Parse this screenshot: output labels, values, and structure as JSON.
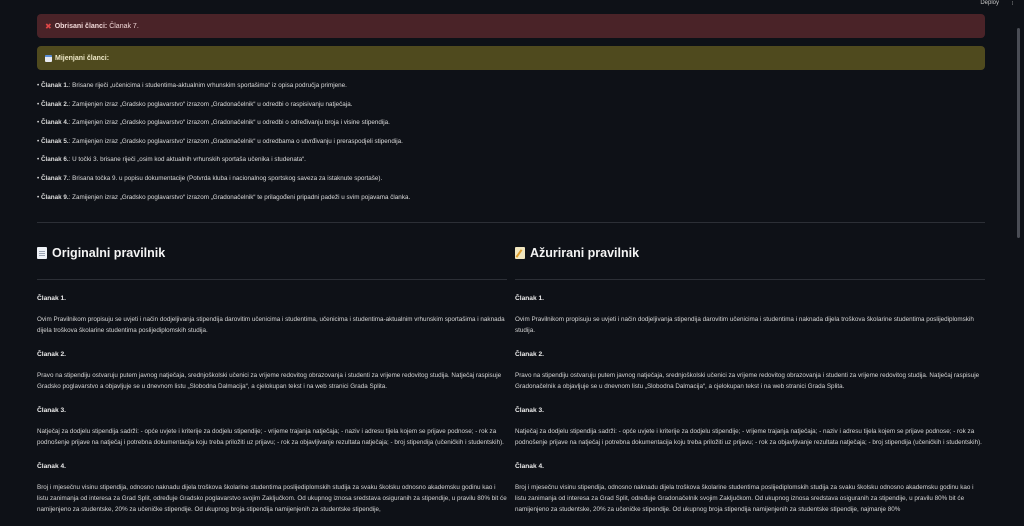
{
  "header": {
    "deploy_label": "Deploy",
    "menu_icon": "⋮"
  },
  "deleted_alert": {
    "icon": "x-icon",
    "label": "Obrisani članci:",
    "value": "Članak 7."
  },
  "changed_alert": {
    "icon": "calendar-icon",
    "label": "Mijenjani članci:"
  },
  "changes": [
    {
      "article": "Članak 1.",
      "text": ": Brisane riječi „učenicima i studentima-aktualnim vrhunskim sportašima“ iz opisa područja primjene."
    },
    {
      "article": "Članak 2.",
      "text": ": Zamijenjen izraz „Gradsko poglavarstvo“ izrazom „Gradonačelnik“ u odredbi o raspisivanju natječaja."
    },
    {
      "article": "Članak 4.",
      "text": ": Zamijenjen izraz „Gradsko poglavarstvo“ izrazom „Gradonačelnik“ u odredbi o određivanju broja i visine stipendija."
    },
    {
      "article": "Članak 5.",
      "text": ": Zamijenjen izraz „Gradsko poglavarstvo“ izrazom „Gradonačelnik“ u odredbama o utvrđivanju i preraspodjeli stipendija."
    },
    {
      "article": "Članak 6.",
      "text": ": U točki 3. brisane riječi „osim kod aktualnih vrhunskih sportaša učenika i studenata“."
    },
    {
      "article": "Članak 7.",
      "text": ": Brisana točka 9. u popisu dokumentacije (Potvrda kluba i nacionalnog sportskog saveza za istaknute sportaše)."
    },
    {
      "article": "Članak 9.",
      "text": ": Zamijenjen izraz „Gradsko poglavarstvo“ izrazom „Gradonačelnik“ te prilagođeni pripadni padeži u svim pojavama članka."
    }
  ],
  "original": {
    "heading": "Originalni pravilnik",
    "articles": [
      {
        "title": "Članak 1.",
        "body": "Ovim Pravilnikom propisuju se uvjeti i način dodjeljivanja stipendija darovitim učenicima i studentima, učenicima i studentima-aktualnim vrhunskim sportašima i naknada dijela troškova školarine studentima poslijediplomskih studija."
      },
      {
        "title": "Članak 2.",
        "body": "Pravo na stipendiju ostvaruju putem javnog natječaja, srednjoškolski učenici za vrijeme redovitog obrazovanja i studenti za vrijeme redovitog studija. Natječaj raspisuje Gradsko poglavarstvo a objavljuje se u dnevnom listu „Slobodna Dalmacija“, a cjelokupan tekst i na web stranici Grada Splita."
      },
      {
        "title": "Članak 3.",
        "body": "Natječaj za dodjelu stipendija sadrži: - opće uvjete i kriterije za dodjelu stipendije; - vrijeme trajanja natječaja; - naziv i adresu tijela kojem se prijave podnose; - rok za podnošenje prijave na natječaj i potrebna dokumentacija koju treba priložiti uz prijavu; - rok za objavljivanje rezultata natječaja; - broj stipendija (učeničkih i studentskih)."
      },
      {
        "title": "Članak 4.",
        "body": "Broj i mjesečnu visinu stipendija, odnosno naknadu dijela troškova školarine studentima poslijediplomskih studija za svaku školsku odnosno akademsku godinu kao i listu zanimanja od interesa za Grad Split, određuje Gradsko poglavarstvo svojim Zaključkom. Od ukupnog iznosa sredstava osiguranih za stipendije, u pravilu 80% bit će namijenjeno za studentske, 20% za učeničke stipendije. Od ukupnog broja stipendija namijenjenih za studentske stipendije,"
      }
    ]
  },
  "updated": {
    "heading": "Ažurirani pravilnik",
    "articles": [
      {
        "title": "Članak 1.",
        "body": "Ovim Pravilnikom propisuju se uvjeti i način dodjeljivanja stipendija darovitim učenicima i studentima i naknada dijela troškova školarine studentima poslijediplomskih studija."
      },
      {
        "title": "Članak 2.",
        "body": "Pravo na stipendiju ostvaruju putem javnog natječaja, srednjoškolski učenici za vrijeme redovitog obrazovanja i studenti za vrijeme redovitog studija. Natječaj raspisuje Gradonačelnik a objavljuje se u dnevnom listu „Slobodna Dalmacija“, a cjelokupan tekst i na web stranici Grada Splita."
      },
      {
        "title": "Članak 3.",
        "body": "Natječaj za dodjelu stipendija sadrži: - opće uvjete i kriterije za dodjelu stipendije; - vrijeme trajanja natječaja; - naziv i adresu tijela kojem se prijave podnose; - rok za podnošenje prijave na natječaj i potrebna dokumentacija koju treba priložiti uz prijavu; - rok za objavljivanje rezultata natječaja; - broj stipendija (učeničkih i studentskih)."
      },
      {
        "title": "Članak 4.",
        "body": "Broj i mjesečnu visinu stipendija, odnosno naknadu dijela troškova školarine studentima poslijediplomskih studija za svaku školsku odnosno akademsku godinu kao i listu zanimanja od interesa za Grad Split, određuje Gradonačelnik svojim Zaključkom. Od ukupnog iznosa sredstava osiguranih za stipendije, u pravilu 80% bit će namijenjeno za studentske, 20% za učeničke stipendije. Od ukupnog broja stipendija namijenjenih za studentske stipendije, najmanje 80%"
      }
    ]
  }
}
